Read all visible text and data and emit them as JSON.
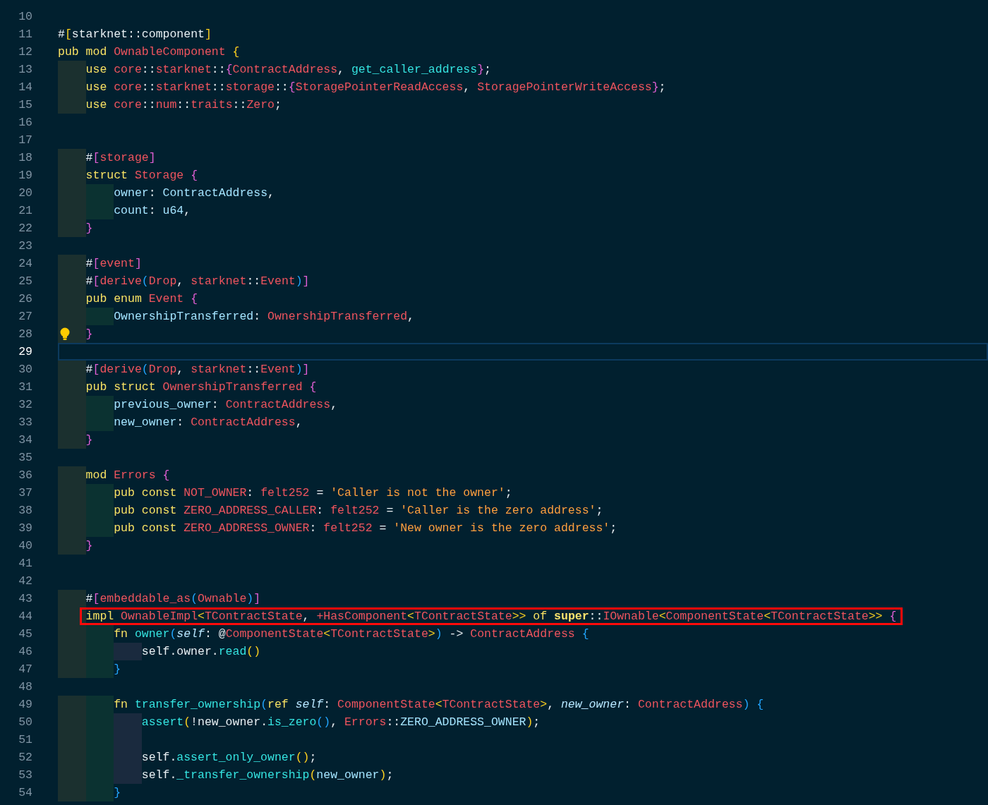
{
  "editor": {
    "lines": [
      {
        "number": "10",
        "current": false,
        "boxed": false,
        "hint": false
      },
      {
        "number": "11",
        "current": false,
        "boxed": false,
        "hint": false,
        "tokens": [
          {
            "kind": "p",
            "text": "#"
          },
          {
            "kind": "b1",
            "text": "["
          },
          {
            "kind": "p",
            "text": "starknet::component"
          },
          {
            "kind": "b1",
            "text": "]"
          }
        ]
      },
      {
        "number": "12",
        "current": false,
        "boxed": false,
        "hint": false,
        "tokens": [
          {
            "kind": "kw",
            "text": "pub mod "
          },
          {
            "kind": "type",
            "text": "OwnableComponent "
          },
          {
            "kind": "b1",
            "text": "{"
          }
        ]
      },
      {
        "number": "13",
        "current": false,
        "boxed": false,
        "hint": false,
        "guides": [
          {
            "color": "#1b302f"
          }
        ],
        "tokens": [
          {
            "kind": "kw",
            "text": "use "
          },
          {
            "kind": "type",
            "text": "core"
          },
          {
            "kind": "p",
            "text": "::"
          },
          {
            "kind": "type",
            "text": "starknet"
          },
          {
            "kind": "p",
            "text": "::"
          },
          {
            "kind": "b2",
            "text": "{"
          },
          {
            "kind": "type",
            "text": "ContractAddress"
          },
          {
            "kind": "p",
            "text": ", "
          },
          {
            "kind": "fn",
            "text": "get_caller_address"
          },
          {
            "kind": "b2",
            "text": "}"
          },
          {
            "kind": "p",
            "text": ";"
          }
        ]
      },
      {
        "number": "14",
        "current": false,
        "boxed": false,
        "hint": false,
        "guides": [
          {
            "color": "#1b302f"
          }
        ],
        "tokens": [
          {
            "kind": "kw",
            "text": "use "
          },
          {
            "kind": "type",
            "text": "core"
          },
          {
            "kind": "p",
            "text": "::"
          },
          {
            "kind": "type",
            "text": "starknet"
          },
          {
            "kind": "p",
            "text": "::"
          },
          {
            "kind": "type",
            "text": "storage"
          },
          {
            "kind": "p",
            "text": "::"
          },
          {
            "kind": "b2",
            "text": "{"
          },
          {
            "kind": "type",
            "text": "StoragePointerReadAccess"
          },
          {
            "kind": "p",
            "text": ", "
          },
          {
            "kind": "type",
            "text": "StoragePointerWriteAccess"
          },
          {
            "kind": "b2",
            "text": "}"
          },
          {
            "kind": "p",
            "text": ";"
          }
        ]
      },
      {
        "number": "15",
        "current": false,
        "boxed": false,
        "hint": false,
        "guides": [
          {
            "color": "#1b302f"
          }
        ],
        "tokens": [
          {
            "kind": "kw",
            "text": "use "
          },
          {
            "kind": "type",
            "text": "core"
          },
          {
            "kind": "p",
            "text": "::"
          },
          {
            "kind": "type",
            "text": "num"
          },
          {
            "kind": "p",
            "text": "::"
          },
          {
            "kind": "type",
            "text": "traits"
          },
          {
            "kind": "p",
            "text": "::"
          },
          {
            "kind": "type",
            "text": "Zero"
          },
          {
            "kind": "p",
            "text": ";"
          }
        ]
      },
      {
        "number": "16",
        "current": false,
        "boxed": false,
        "hint": false
      },
      {
        "number": "17",
        "current": false,
        "boxed": false,
        "hint": false
      },
      {
        "number": "18",
        "current": false,
        "boxed": false,
        "hint": false,
        "guides": [
          {
            "color": "#1b302f"
          }
        ],
        "tokens": [
          {
            "kind": "p",
            "text": "#"
          },
          {
            "kind": "b2",
            "text": "["
          },
          {
            "kind": "type",
            "text": "storage"
          },
          {
            "kind": "b2",
            "text": "]"
          }
        ]
      },
      {
        "number": "19",
        "current": false,
        "boxed": false,
        "hint": false,
        "guides": [
          {
            "color": "#1b302f"
          }
        ],
        "tokens": [
          {
            "kind": "kw",
            "text": "struct "
          },
          {
            "kind": "type",
            "text": "Storage "
          },
          {
            "kind": "b2",
            "text": "{"
          }
        ]
      },
      {
        "number": "20",
        "current": false,
        "boxed": false,
        "hint": false,
        "guides": [
          {
            "color": "#1b302f"
          },
          {
            "color": "#0b3231"
          }
        ],
        "tokens": [
          {
            "kind": "field",
            "text": "owner"
          },
          {
            "kind": "p",
            "text": ": "
          },
          {
            "kind": "field",
            "text": "ContractAddress"
          },
          {
            "kind": "p",
            "text": ","
          }
        ]
      },
      {
        "number": "21",
        "current": false,
        "boxed": false,
        "hint": false,
        "guides": [
          {
            "color": "#1b302f"
          },
          {
            "color": "#0b3231"
          }
        ],
        "tokens": [
          {
            "kind": "field",
            "text": "count"
          },
          {
            "kind": "p",
            "text": ": "
          },
          {
            "kind": "field",
            "text": "u64"
          },
          {
            "kind": "p",
            "text": ","
          }
        ]
      },
      {
        "number": "22",
        "current": false,
        "boxed": false,
        "hint": false,
        "guides": [
          {
            "color": "#1b302f"
          }
        ],
        "tokens": [
          {
            "kind": "b2",
            "text": "}"
          }
        ]
      },
      {
        "number": "23",
        "current": false,
        "boxed": false,
        "hint": false
      },
      {
        "number": "24",
        "current": false,
        "boxed": false,
        "hint": false,
        "guides": [
          {
            "color": "#1b302f"
          }
        ],
        "tokens": [
          {
            "kind": "p",
            "text": "#"
          },
          {
            "kind": "b2",
            "text": "["
          },
          {
            "kind": "type",
            "text": "event"
          },
          {
            "kind": "b2",
            "text": "]"
          }
        ]
      },
      {
        "number": "25",
        "current": false,
        "boxed": false,
        "hint": false,
        "guides": [
          {
            "color": "#1b302f"
          }
        ],
        "tokens": [
          {
            "kind": "p",
            "text": "#"
          },
          {
            "kind": "b2",
            "text": "["
          },
          {
            "kind": "type",
            "text": "derive"
          },
          {
            "kind": "b3",
            "text": "("
          },
          {
            "kind": "type",
            "text": "Drop"
          },
          {
            "kind": "p",
            "text": ", "
          },
          {
            "kind": "type",
            "text": "starknet"
          },
          {
            "kind": "p",
            "text": "::"
          },
          {
            "kind": "type",
            "text": "Event"
          },
          {
            "kind": "b3",
            "text": ")"
          },
          {
            "kind": "b2",
            "text": "]"
          }
        ]
      },
      {
        "number": "26",
        "current": false,
        "boxed": false,
        "hint": false,
        "guides": [
          {
            "color": "#1b302f"
          }
        ],
        "tokens": [
          {
            "kind": "kw",
            "text": "pub enum "
          },
          {
            "kind": "type",
            "text": "Event "
          },
          {
            "kind": "b2",
            "text": "{"
          }
        ]
      },
      {
        "number": "27",
        "current": false,
        "boxed": false,
        "hint": false,
        "guides": [
          {
            "color": "#1b302f"
          },
          {
            "color": "#0b3231"
          }
        ],
        "tokens": [
          {
            "kind": "field",
            "text": "OwnershipTransferred"
          },
          {
            "kind": "p",
            "text": ": "
          },
          {
            "kind": "type",
            "text": "OwnershipTransferred"
          },
          {
            "kind": "p",
            "text": ","
          }
        ]
      },
      {
        "number": "28",
        "current": false,
        "boxed": false,
        "hint": true,
        "guides": [
          {
            "color": "#1b302f"
          }
        ],
        "tokens": [
          {
            "kind": "b2",
            "text": "}"
          }
        ]
      },
      {
        "number": "29",
        "current": true,
        "boxed": false,
        "hint": false
      },
      {
        "number": "30",
        "current": false,
        "boxed": false,
        "hint": false,
        "guides": [
          {
            "color": "#1b302f"
          }
        ],
        "tokens": [
          {
            "kind": "p",
            "text": "#"
          },
          {
            "kind": "b2",
            "text": "["
          },
          {
            "kind": "type",
            "text": "derive"
          },
          {
            "kind": "b3",
            "text": "("
          },
          {
            "kind": "type",
            "text": "Drop"
          },
          {
            "kind": "p",
            "text": ", "
          },
          {
            "kind": "type",
            "text": "starknet"
          },
          {
            "kind": "p",
            "text": "::"
          },
          {
            "kind": "type",
            "text": "Event"
          },
          {
            "kind": "b3",
            "text": ")"
          },
          {
            "kind": "b2",
            "text": "]"
          }
        ]
      },
      {
        "number": "31",
        "current": false,
        "boxed": false,
        "hint": false,
        "guides": [
          {
            "color": "#1b302f"
          }
        ],
        "tokens": [
          {
            "kind": "kw",
            "text": "pub struct "
          },
          {
            "kind": "type",
            "text": "OwnershipTransferred "
          },
          {
            "kind": "b2",
            "text": "{"
          }
        ]
      },
      {
        "number": "32",
        "current": false,
        "boxed": false,
        "hint": false,
        "guides": [
          {
            "color": "#1b302f"
          },
          {
            "color": "#0b3231"
          }
        ],
        "tokens": [
          {
            "kind": "field",
            "text": "previous_owner"
          },
          {
            "kind": "p",
            "text": ": "
          },
          {
            "kind": "type",
            "text": "ContractAddress"
          },
          {
            "kind": "p",
            "text": ","
          }
        ]
      },
      {
        "number": "33",
        "current": false,
        "boxed": false,
        "hint": false,
        "guides": [
          {
            "color": "#1b302f"
          },
          {
            "color": "#0b3231"
          }
        ],
        "tokens": [
          {
            "kind": "field",
            "text": "new_owner"
          },
          {
            "kind": "p",
            "text": ": "
          },
          {
            "kind": "type",
            "text": "ContractAddress"
          },
          {
            "kind": "p",
            "text": ","
          }
        ]
      },
      {
        "number": "34",
        "current": false,
        "boxed": false,
        "hint": false,
        "guides": [
          {
            "color": "#1b302f"
          }
        ],
        "tokens": [
          {
            "kind": "b2",
            "text": "}"
          }
        ]
      },
      {
        "number": "35",
        "current": false,
        "boxed": false,
        "hint": false
      },
      {
        "number": "36",
        "current": false,
        "boxed": false,
        "hint": false,
        "guides": [
          {
            "color": "#1b302f"
          }
        ],
        "tokens": [
          {
            "kind": "kw",
            "text": "mod "
          },
          {
            "kind": "type",
            "text": "Errors "
          },
          {
            "kind": "b2",
            "text": "{"
          }
        ]
      },
      {
        "number": "37",
        "current": false,
        "boxed": false,
        "hint": false,
        "guides": [
          {
            "color": "#1b302f"
          },
          {
            "color": "#0b3231"
          }
        ],
        "tokens": [
          {
            "kind": "kw",
            "text": "pub const "
          },
          {
            "kind": "type",
            "text": "NOT_OWNER"
          },
          {
            "kind": "p",
            "text": ": "
          },
          {
            "kind": "type",
            "text": "felt252 "
          },
          {
            "kind": "p",
            "text": "= "
          },
          {
            "kind": "str",
            "text": "'Caller is not the owner'"
          },
          {
            "kind": "p",
            "text": ";"
          }
        ]
      },
      {
        "number": "38",
        "current": false,
        "boxed": false,
        "hint": false,
        "guides": [
          {
            "color": "#1b302f"
          },
          {
            "color": "#0b3231"
          }
        ],
        "tokens": [
          {
            "kind": "kw",
            "text": "pub const "
          },
          {
            "kind": "type",
            "text": "ZERO_ADDRESS_CALLER"
          },
          {
            "kind": "p",
            "text": ": "
          },
          {
            "kind": "type",
            "text": "felt252 "
          },
          {
            "kind": "p",
            "text": "= "
          },
          {
            "kind": "str",
            "text": "'Caller is the zero address'"
          },
          {
            "kind": "p",
            "text": ";"
          }
        ]
      },
      {
        "number": "39",
        "current": false,
        "boxed": false,
        "hint": false,
        "guides": [
          {
            "color": "#1b302f"
          },
          {
            "color": "#0b3231"
          }
        ],
        "tokens": [
          {
            "kind": "kw",
            "text": "pub const "
          },
          {
            "kind": "type",
            "text": "ZERO_ADDRESS_OWNER"
          },
          {
            "kind": "p",
            "text": ": "
          },
          {
            "kind": "type",
            "text": "felt252 "
          },
          {
            "kind": "p",
            "text": "= "
          },
          {
            "kind": "str",
            "text": "'New owner is the zero address'"
          },
          {
            "kind": "p",
            "text": ";"
          }
        ]
      },
      {
        "number": "40",
        "current": false,
        "boxed": false,
        "hint": false,
        "guides": [
          {
            "color": "#1b302f"
          }
        ],
        "tokens": [
          {
            "kind": "b2",
            "text": "}"
          }
        ]
      },
      {
        "number": "41",
        "current": false,
        "boxed": false,
        "hint": false
      },
      {
        "number": "42",
        "current": false,
        "boxed": false,
        "hint": false
      },
      {
        "number": "43",
        "current": false,
        "boxed": false,
        "hint": false,
        "guides": [
          {
            "color": "#1b302f"
          }
        ],
        "tokens": [
          {
            "kind": "p",
            "text": "#"
          },
          {
            "kind": "b2",
            "text": "["
          },
          {
            "kind": "type",
            "text": "embeddable_as"
          },
          {
            "kind": "b3",
            "text": "("
          },
          {
            "kind": "type",
            "text": "Ownable"
          },
          {
            "kind": "b3",
            "text": ")"
          },
          {
            "kind": "b2",
            "text": "]"
          }
        ]
      },
      {
        "number": "44",
        "current": false,
        "boxed": true,
        "hint": false,
        "guides": [
          {
            "color": "#1b302f"
          }
        ],
        "tokens": [
          {
            "kind": "kw",
            "text": "impl "
          },
          {
            "kind": "type",
            "text": "OwnableImpl"
          },
          {
            "kind": "b1",
            "text": "<"
          },
          {
            "kind": "type",
            "text": "TContractState"
          },
          {
            "kind": "p",
            "text": ", "
          },
          {
            "kind": "type",
            "text": "+HasComponent"
          },
          {
            "kind": "b1",
            "text": "<"
          },
          {
            "kind": "type",
            "text": "TContractState"
          },
          {
            "kind": "b1",
            "text": ">> "
          },
          {
            "kind": "kw",
            "text": "of "
          },
          {
            "kind": "kwb",
            "text": "super"
          },
          {
            "kind": "p",
            "text": "::"
          },
          {
            "kind": "type",
            "text": "IOwnable"
          },
          {
            "kind": "b1",
            "text": "<"
          },
          {
            "kind": "type",
            "text": "ComponentState"
          },
          {
            "kind": "b1",
            "text": "<"
          },
          {
            "kind": "type",
            "text": "TContractState"
          },
          {
            "kind": "b1",
            "text": ">> "
          },
          {
            "kind": "b2",
            "text": "{"
          }
        ]
      },
      {
        "number": "45",
        "current": false,
        "boxed": false,
        "hint": false,
        "guides": [
          {
            "color": "#1b302f"
          },
          {
            "color": "#0b3231"
          }
        ],
        "tokens": [
          {
            "kind": "kw",
            "text": "fn "
          },
          {
            "kind": "fn",
            "text": "owner"
          },
          {
            "kind": "b3",
            "text": "("
          },
          {
            "kind": "it",
            "text": "self"
          },
          {
            "kind": "p",
            "text": ": @"
          },
          {
            "kind": "type",
            "text": "ComponentState"
          },
          {
            "kind": "b1",
            "text": "<"
          },
          {
            "kind": "type",
            "text": "TContractState"
          },
          {
            "kind": "b1",
            "text": ">"
          },
          {
            "kind": "b3",
            "text": ") "
          },
          {
            "kind": "p",
            "text": "-> "
          },
          {
            "kind": "type",
            "text": "ContractAddress "
          },
          {
            "kind": "b3",
            "text": "{"
          }
        ]
      },
      {
        "number": "46",
        "current": false,
        "boxed": false,
        "hint": false,
        "guides": [
          {
            "color": "#1b302f"
          },
          {
            "color": "#0b3231"
          },
          {
            "color": "#1a2a3e"
          }
        ],
        "tokens": [
          {
            "kind": "p",
            "text": "self.owner."
          },
          {
            "kind": "fn",
            "text": "read"
          },
          {
            "kind": "b1",
            "text": "()"
          }
        ]
      },
      {
        "number": "47",
        "current": false,
        "boxed": false,
        "hint": false,
        "guides": [
          {
            "color": "#1b302f"
          },
          {
            "color": "#0b3231"
          }
        ],
        "tokens": [
          {
            "kind": "b3",
            "text": "}"
          }
        ]
      },
      {
        "number": "48",
        "current": false,
        "boxed": false,
        "hint": false
      },
      {
        "number": "49",
        "current": false,
        "boxed": false,
        "hint": false,
        "guides": [
          {
            "color": "#1b302f"
          },
          {
            "color": "#0b3231"
          }
        ],
        "tokens": [
          {
            "kind": "kw",
            "text": "fn "
          },
          {
            "kind": "fn",
            "text": "transfer_ownership"
          },
          {
            "kind": "b3",
            "text": "("
          },
          {
            "kind": "kw",
            "text": "ref "
          },
          {
            "kind": "it",
            "text": "self"
          },
          {
            "kind": "p",
            "text": ": "
          },
          {
            "kind": "type",
            "text": "ComponentState"
          },
          {
            "kind": "b1",
            "text": "<"
          },
          {
            "kind": "type",
            "text": "TContractState"
          },
          {
            "kind": "b1",
            "text": ">"
          },
          {
            "kind": "p",
            "text": ", "
          },
          {
            "kind": "it",
            "text": "new_owner"
          },
          {
            "kind": "p",
            "text": ": "
          },
          {
            "kind": "type",
            "text": "ContractAddress"
          },
          {
            "kind": "b3",
            "text": ") {"
          }
        ]
      },
      {
        "number": "50",
        "current": false,
        "boxed": false,
        "hint": false,
        "guides": [
          {
            "color": "#1b302f"
          },
          {
            "color": "#0b3231"
          },
          {
            "color": "#1a2a3e"
          }
        ],
        "tokens": [
          {
            "kind": "fn",
            "text": "assert"
          },
          {
            "kind": "b1",
            "text": "("
          },
          {
            "kind": "p",
            "text": "!new_owner."
          },
          {
            "kind": "fn",
            "text": "is_zero"
          },
          {
            "kind": "b3",
            "text": "()"
          },
          {
            "kind": "p",
            "text": ", "
          },
          {
            "kind": "type",
            "text": "Errors"
          },
          {
            "kind": "p",
            "text": "::"
          },
          {
            "kind": "field",
            "text": "ZERO_ADDRESS_OWNER"
          },
          {
            "kind": "b1",
            "text": ")"
          },
          {
            "kind": "p",
            "text": ";"
          }
        ]
      },
      {
        "number": "51",
        "current": false,
        "boxed": false,
        "hint": false,
        "guides": [
          {
            "color": "#1b302f"
          },
          {
            "color": "#0b3231"
          },
          {
            "color": "#1a2a3e"
          }
        ]
      },
      {
        "number": "52",
        "current": false,
        "boxed": false,
        "hint": false,
        "guides": [
          {
            "color": "#1b302f"
          },
          {
            "color": "#0b3231"
          },
          {
            "color": "#1a2a3e"
          }
        ],
        "tokens": [
          {
            "kind": "p",
            "text": "self."
          },
          {
            "kind": "fn",
            "text": "assert_only_owner"
          },
          {
            "kind": "b1",
            "text": "()"
          },
          {
            "kind": "p",
            "text": ";"
          }
        ]
      },
      {
        "number": "53",
        "current": false,
        "boxed": false,
        "hint": false,
        "guides": [
          {
            "color": "#1b302f"
          },
          {
            "color": "#0b3231"
          },
          {
            "color": "#1a2a3e"
          }
        ],
        "tokens": [
          {
            "kind": "p",
            "text": "self."
          },
          {
            "kind": "fn",
            "text": "_transfer_ownership"
          },
          {
            "kind": "b1",
            "text": "("
          },
          {
            "kind": "field",
            "text": "new_owner"
          },
          {
            "kind": "b1",
            "text": ")"
          },
          {
            "kind": "p",
            "text": ";"
          }
        ]
      },
      {
        "number": "54",
        "current": false,
        "boxed": false,
        "hint": false,
        "guides": [
          {
            "color": "#1b302f"
          },
          {
            "color": "#0b3231"
          }
        ],
        "tokens": [
          {
            "kind": "b3",
            "text": "}"
          }
        ]
      }
    ]
  }
}
